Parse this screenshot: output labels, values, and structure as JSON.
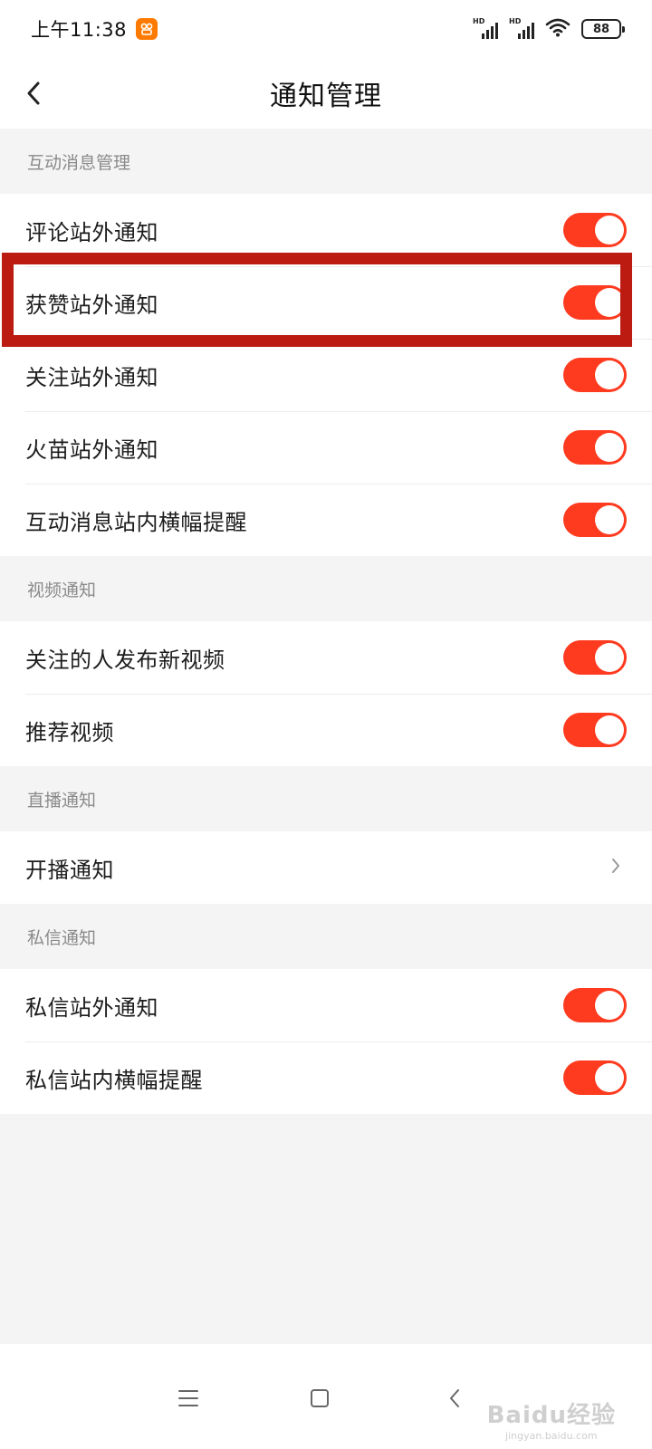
{
  "status_bar": {
    "time": "上午11:38",
    "network_label_1": "HD",
    "network_label_2": "HD",
    "battery": "88"
  },
  "header": {
    "title": "通知管理"
  },
  "sections": [
    {
      "title": "互动消息管理",
      "items": [
        {
          "label": "评论站外通知",
          "control": "toggle",
          "enabled": true
        },
        {
          "label": "获赞站外通知",
          "control": "toggle",
          "enabled": true
        },
        {
          "label": "关注站外通知",
          "control": "toggle",
          "enabled": true
        },
        {
          "label": "火苗站外通知",
          "control": "toggle",
          "enabled": true
        },
        {
          "label": "互动消息站内横幅提醒",
          "control": "toggle",
          "enabled": true
        }
      ]
    },
    {
      "title": "视频通知",
      "items": [
        {
          "label": "关注的人发布新视频",
          "control": "toggle",
          "enabled": true
        },
        {
          "label": "推荐视频",
          "control": "toggle",
          "enabled": true
        }
      ]
    },
    {
      "title": "直播通知",
      "items": [
        {
          "label": "开播通知",
          "control": "chevron"
        }
      ]
    },
    {
      "title": "私信通知",
      "items": [
        {
          "label": "私信站外通知",
          "control": "toggle",
          "enabled": true
        },
        {
          "label": "私信站内横幅提醒",
          "control": "toggle",
          "enabled": true
        }
      ]
    }
  ],
  "watermark": {
    "logo": "Baidu经验",
    "sub": "jingyan.baidu.com"
  },
  "colors": {
    "toggle_on": "#fe3a1f",
    "highlight": "#bc1b12",
    "app_badge": "#ff7a00"
  },
  "icons": [
    "back-icon",
    "chevron-right-icon",
    "menu-icon",
    "home-icon",
    "back-nav-icon"
  ]
}
